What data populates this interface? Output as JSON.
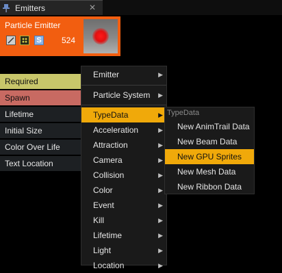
{
  "window": {
    "tab_title": "Emitters",
    "close_glyph": "✕",
    "tab_icon": "pin-icon"
  },
  "emitter": {
    "title": "Particle Emitter",
    "particle_count": "524",
    "toggle_label": "S",
    "icons": [
      "graph-toggle-icon",
      "solo-toggle-icon",
      "sorting-toggle-icon"
    ],
    "preview_icon": "particle-preview-thumbnail"
  },
  "modules": [
    "Required",
    "Spawn",
    "Lifetime",
    "Initial Size",
    "Color Over Life",
    "Text Location"
  ],
  "context_menu": {
    "arrow_glyph": "▶",
    "items": [
      {
        "label": "Emitter",
        "submenu": true
      },
      {
        "label": "Particle System",
        "submenu": true
      },
      {
        "label": "TypeData",
        "submenu": true
      },
      {
        "label": "Acceleration",
        "submenu": true
      },
      {
        "label": "Attraction",
        "submenu": true
      },
      {
        "label": "Camera",
        "submenu": true
      },
      {
        "label": "Collision",
        "submenu": true
      },
      {
        "label": "Color",
        "submenu": true
      },
      {
        "label": "Event",
        "submenu": true
      },
      {
        "label": "Kill",
        "submenu": true
      },
      {
        "label": "Lifetime",
        "submenu": true
      },
      {
        "label": "Light",
        "submenu": true
      },
      {
        "label": "Location",
        "submenu": true
      }
    ],
    "highlighted": "TypeData"
  },
  "typedata_submenu": {
    "heading": "TypeData",
    "items": [
      "New AnimTrail Data",
      "New Beam Data",
      "New GPU Sprites",
      "New Mesh Data",
      "New Ribbon Data"
    ],
    "highlighted": "New GPU Sprites"
  },
  "colors": {
    "emitter_header": "#f25e10",
    "required_module": "#c8c66a",
    "spawn_module": "#c86a62",
    "menu_highlight": "#f0a90a"
  }
}
